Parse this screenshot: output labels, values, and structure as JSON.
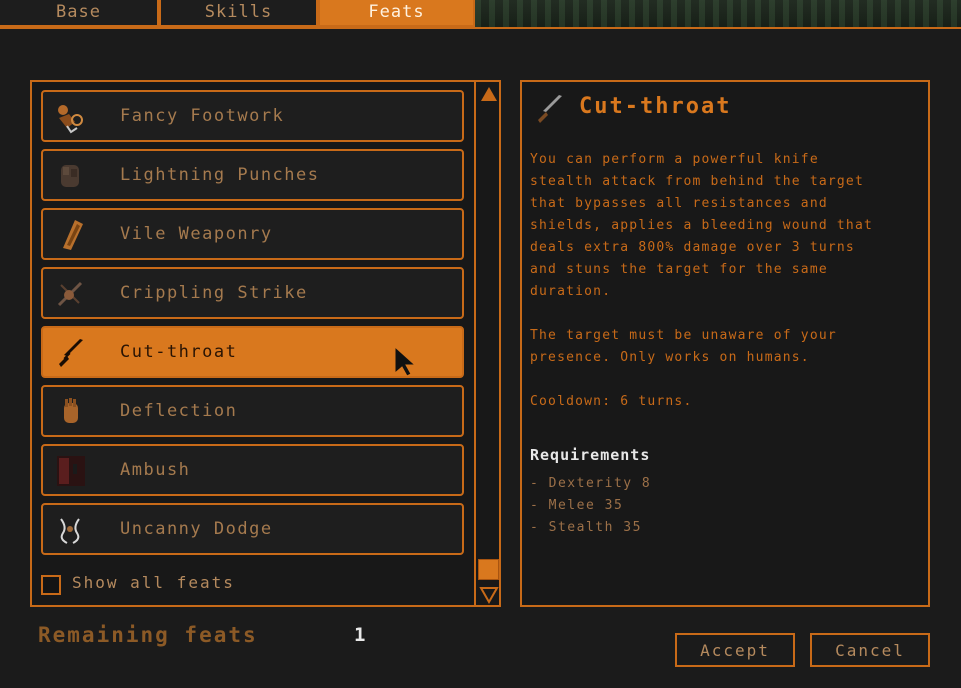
{
  "tabs": [
    {
      "label": "Base"
    },
    {
      "label": "Skills"
    },
    {
      "label": "Feats"
    }
  ],
  "feats": [
    {
      "label": "Fancy Footwork",
      "icon": "footwork-icon"
    },
    {
      "label": "Lightning Punches",
      "icon": "fist-icon"
    },
    {
      "label": "Vile Weaponry",
      "icon": "blade-icon"
    },
    {
      "label": "Crippling Strike",
      "icon": "strike-icon"
    },
    {
      "label": "Cut-throat",
      "icon": "knife-icon",
      "selected": true
    },
    {
      "label": "Deflection",
      "icon": "hand-icon"
    },
    {
      "label": "Ambush",
      "icon": "ambush-icon"
    },
    {
      "label": "Uncanny Dodge",
      "icon": "dodge-icon"
    }
  ],
  "show_all_label": "Show all feats",
  "detail": {
    "title": "Cut-throat",
    "description": "You can perform a powerful knife\nstealth attack from behind the target\nthat bypasses all resistances and\nshields, applies a bleeding wound that\ndeals extra 800% damage over 3 turns\nand stuns the target for the same\nduration.",
    "note": "The target must be unaware of your\npresence. Only works on humans.",
    "cooldown": "Cooldown: 6 turns.",
    "requirements_title": "Requirements",
    "requirements": [
      "- Dexterity 8",
      "- Melee 35",
      "- Stealth 35"
    ]
  },
  "remaining_label": "Remaining feats",
  "remaining_count": "1",
  "buttons": {
    "accept": "Accept",
    "cancel": "Cancel"
  },
  "colors": {
    "accent": "#d9781e",
    "border": "#c86a18",
    "background": "#1a1a1a"
  }
}
